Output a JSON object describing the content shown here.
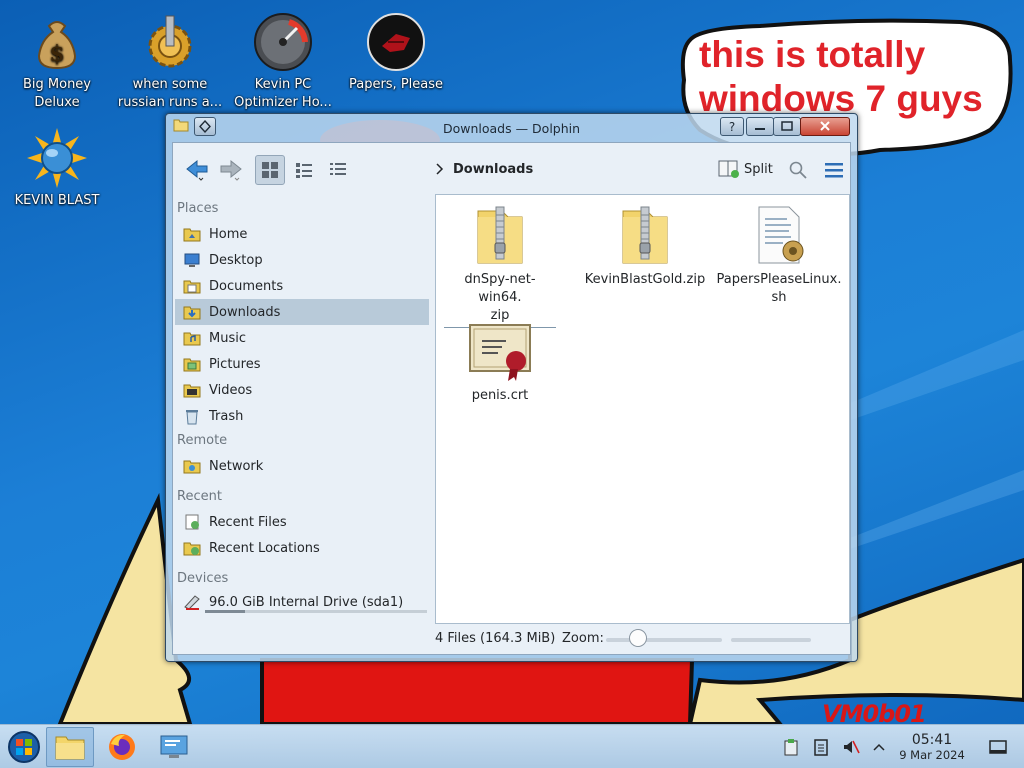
{
  "wallpaper": {
    "speech_text": "this is totally windows 7 guys",
    "stamp": "VM0b01"
  },
  "desktop": {
    "icons": [
      {
        "label": "Big Money\nDeluxe",
        "icon": "money-bag-icon"
      },
      {
        "label": "when some\nrussian runs a...",
        "icon": "gear-icon"
      },
      {
        "label": "Kevin PC\nOptimizer Ho...",
        "icon": "speedometer-icon"
      },
      {
        "label": "Papers, Please",
        "icon": "papers-please-icon"
      },
      {
        "label": "KEVIN BLAST",
        "icon": "globe-burst-icon"
      }
    ]
  },
  "window": {
    "title": "Downloads — Dolphin",
    "breadcrumb": "Downloads",
    "split_label": "Split",
    "sidebar": {
      "places_header": "Places",
      "places": [
        {
          "label": "Home",
          "icon": "home-folder-icon"
        },
        {
          "label": "Desktop",
          "icon": "desktop-folder-icon"
        },
        {
          "label": "Documents",
          "icon": "documents-folder-icon"
        },
        {
          "label": "Downloads",
          "icon": "downloads-folder-icon",
          "selected": true
        },
        {
          "label": "Music",
          "icon": "music-folder-icon"
        },
        {
          "label": "Pictures",
          "icon": "pictures-folder-icon"
        },
        {
          "label": "Videos",
          "icon": "videos-folder-icon"
        },
        {
          "label": "Trash",
          "icon": "trash-icon"
        }
      ],
      "remote_header": "Remote",
      "remote": [
        {
          "label": "Network",
          "icon": "network-folder-icon"
        }
      ],
      "recent_header": "Recent",
      "recent": [
        {
          "label": "Recent Files",
          "icon": "recent-files-icon"
        },
        {
          "label": "Recent Locations",
          "icon": "recent-locations-icon"
        }
      ],
      "devices_header": "Devices",
      "devices": [
        {
          "label": "96.0 GiB Internal Drive (sda1)",
          "icon": "drive-icon",
          "usage_fraction": 0.18
        }
      ]
    },
    "files": [
      {
        "name": "dnSpy-net-win64.\nzip",
        "icon": "zip-icon"
      },
      {
        "name": "KevinBlastGold.zip",
        "icon": "zip-icon"
      },
      {
        "name": "PapersPleaseLinux.\nsh",
        "icon": "script-icon"
      },
      {
        "name": "penis.crt",
        "icon": "certificate-icon"
      }
    ],
    "status_text": "4 Files (164.3 MiB)",
    "zoom_label": "Zoom:",
    "zoom_fraction": 0.28
  },
  "taskbar": {
    "time": "05:41",
    "date": "9 Mar 2024"
  },
  "colors": {
    "desktop_blue": "#1c7fd6",
    "selection": "#b8cad9",
    "speech_red": "#e0232a"
  }
}
